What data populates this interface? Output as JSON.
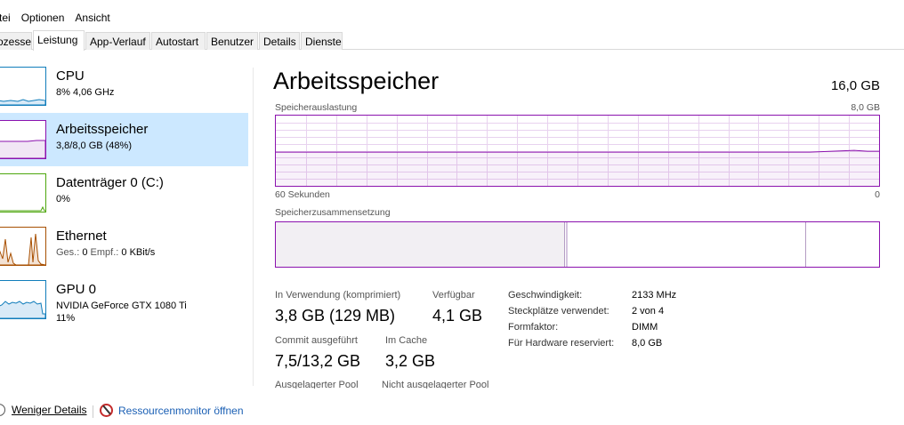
{
  "menu": [
    "tei",
    "Optionen",
    "Ansicht"
  ],
  "tabs": [
    {
      "label": "ozesse",
      "active": false
    },
    {
      "label": "Leistung",
      "active": true
    },
    {
      "label": "App-Verlauf",
      "active": false
    },
    {
      "label": "Autostart",
      "active": false
    },
    {
      "label": "Benutzer",
      "active": false
    },
    {
      "label": "Details",
      "active": false
    },
    {
      "label": "Dienste",
      "active": false
    }
  ],
  "resources": {
    "cpu": {
      "title": "CPU",
      "sub": "8% 4,06 GHz"
    },
    "memory": {
      "title": "Arbeitsspeicher",
      "sub": "3,8/8,0 GB (48%)"
    },
    "disk": {
      "title": "Datenträger 0 (C:)",
      "sub": "0%"
    },
    "ethernet": {
      "title": "Ethernet",
      "sub_send_label": "Ges.:",
      "sub_send": "0",
      "sub_recv_label": "Empf.:",
      "sub_recv": "0 KBit/s"
    },
    "gpu": {
      "title": "GPU 0",
      "sub": "NVIDIA GeForce GTX 1080 Ti",
      "sub2": "11%"
    }
  },
  "main": {
    "title": "Arbeitsspeicher",
    "total": "16,0 GB",
    "usage_chart_label": "Speicherauslastung",
    "usage_chart_max": "8,0 GB",
    "time_left": "60 Sekunden",
    "time_right": "0",
    "composition_label": "Speicherzusammensetzung",
    "composition": {
      "in_use_fraction": 0.48,
      "standby_start_fraction": 0.875
    }
  },
  "stats": {
    "in_use_label": "In Verwendung (komprimiert)",
    "in_use_value": "3,8 GB (129 MB)",
    "available_label": "Verfügbar",
    "available_value": "4,1 GB",
    "commit_label": "Commit ausgeführt",
    "commit_value": "7,5/13,2 GB",
    "cache_label": "Im Cache",
    "cache_value": "3,2 GB",
    "paged_label": "Ausgelagerter Pool",
    "nonpaged_label": "Nicht ausgelagerter Pool"
  },
  "specs": [
    {
      "key": "Geschwindigkeit:",
      "value": "2133 MHz"
    },
    {
      "key": "Steckplätze verwendet:",
      "value": "2 von 4"
    },
    {
      "key": "Formfaktor:",
      "value": "DIMM"
    },
    {
      "key": "Für Hardware reserviert:",
      "value": "8,0 GB"
    }
  ],
  "bottom": {
    "less_details": "Weniger Details",
    "resource_monitor": "Ressourcenmonitor öffnen"
  },
  "colors": {
    "memory_accent": "#8b12ae",
    "cpu_accent": "#117dbb",
    "disk_accent": "#4da60c",
    "ethernet_accent": "#a74f01",
    "selected_bg": "#cce8ff"
  },
  "icons": {
    "less_details": "chevron-up-circle-icon",
    "resource_monitor": "resource-monitor-icon"
  }
}
